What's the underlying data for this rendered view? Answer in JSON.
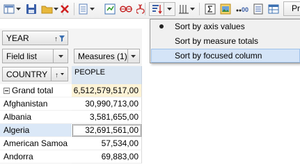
{
  "toolbar": {
    "icons": [
      "chart-layout-icon",
      "save-icon",
      "open-folder-icon",
      "delete-icon",
      "export-icon",
      "refresh-icon",
      "infinity-icon",
      "sort-icon",
      "sort-dropdown-icon",
      "grid-columns-icon",
      "sum-icon",
      "image-icon",
      "format-icon",
      "document-icon",
      "table-icon"
    ],
    "partial_button_label": "Pr"
  },
  "filters": {
    "year_label": "YEAR",
    "field_list_label": "Field list",
    "measures_label": "Measures (1)",
    "country_label": "COUNTRY"
  },
  "grid": {
    "measure_header": "PEOPLE",
    "rows": [
      {
        "label": "Grand total",
        "value": "6,512,579,517,00"
      },
      {
        "label": "Afghanistan",
        "value": "30,990,713,00"
      },
      {
        "label": "Albania",
        "value": "3,581,655,00"
      },
      {
        "label": "Algeria",
        "value": "32,691,561,00"
      },
      {
        "label": "American Samoa",
        "value": "57,534,00"
      },
      {
        "label": "Andorra",
        "value": "69,883,00"
      }
    ]
  },
  "sort_menu": {
    "items": [
      {
        "label": "Sort by axis values",
        "checked": true
      },
      {
        "label": "Sort by measure totals",
        "checked": false
      },
      {
        "label": "Sort by focused column",
        "checked": false,
        "highlighted": true
      }
    ]
  }
}
